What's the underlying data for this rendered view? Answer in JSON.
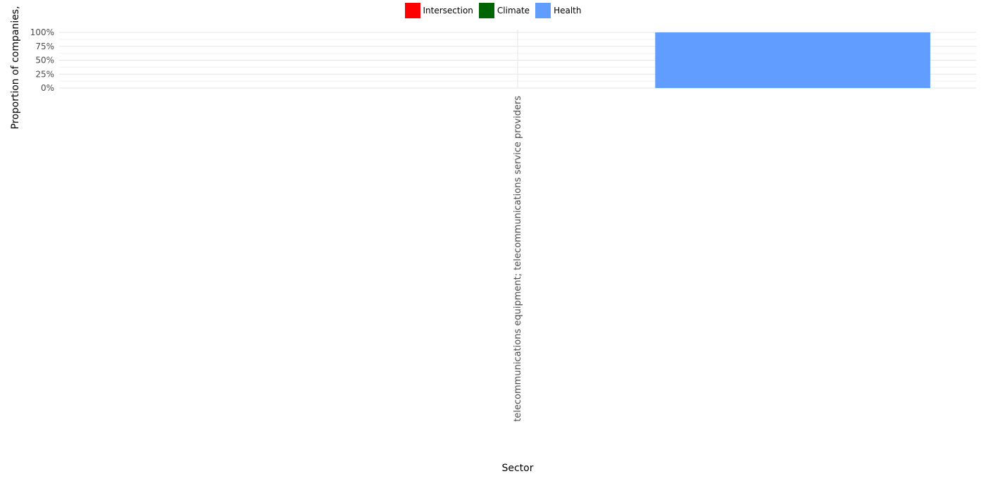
{
  "chart_data": {
    "type": "bar",
    "stacked": true,
    "categories": [
      "telecommunications equipment; telecommunications service providers"
    ],
    "series": [
      {
        "name": "Intersection",
        "color": "#ff0000",
        "values": [
          0
        ]
      },
      {
        "name": "Climate",
        "color": "#006400",
        "values": [
          0
        ]
      },
      {
        "name": "Health",
        "color": "#619cff",
        "values": [
          1.0
        ]
      }
    ],
    "xlabel": "Sector",
    "ylabel": "Proportion of companies,",
    "ylim": [
      0,
      1
    ],
    "yticks": [
      "0%",
      "25%",
      "50%",
      "75%",
      "100%"
    ],
    "legend_position": "top",
    "grid": true
  }
}
